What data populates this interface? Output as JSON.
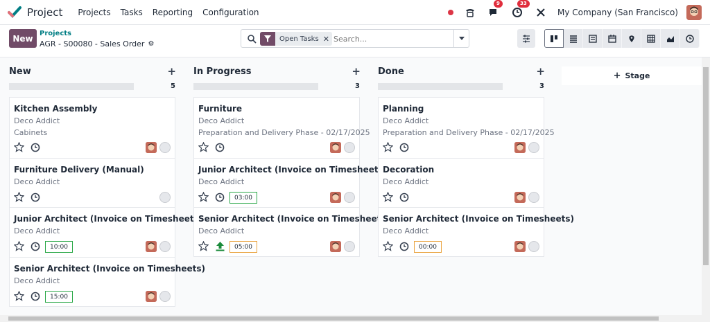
{
  "app": {
    "name": "Project",
    "logo_icon": "odoo-check-icon"
  },
  "nav": {
    "items": [
      "Projects",
      "Tasks",
      "Reporting",
      "Configuration"
    ]
  },
  "systray": {
    "phone_icon": "phone-icon",
    "chat_badge": "9",
    "activity_badge": "33",
    "company": "My Company (San Francisco)"
  },
  "control": {
    "new_label": "New",
    "breadcrumb_parent": "Projects",
    "breadcrumb_current": "AGR - S00080 - Sales Order",
    "search": {
      "facet": "Open Tasks",
      "placeholder": "Search..."
    }
  },
  "columns": [
    {
      "title": "New",
      "count": "5",
      "cards": [
        {
          "title": "Kitchen Assembly",
          "customer": "Deco Addict",
          "extra": "Cabinets",
          "hours": "",
          "avatar": true
        },
        {
          "title": "Furniture Delivery (Manual)",
          "customer": "Deco Addict",
          "extra": "",
          "hours": "",
          "avatar": false
        },
        {
          "title": "Junior Architect (Invoice on Timesheets)",
          "customer": "Deco Addict",
          "extra": "",
          "hours": "10:00",
          "avatar": true
        },
        {
          "title": "Senior Architect (Invoice on Timesheets)",
          "customer": "Deco Addict",
          "extra": "",
          "hours": "15:00",
          "avatar": true
        }
      ]
    },
    {
      "title": "In Progress",
      "count": "3",
      "cards": [
        {
          "title": "Furniture",
          "customer": "Deco Addict",
          "extra": "Preparation and Delivery Phase - 02/17/2025",
          "hours": "",
          "avatar": true
        },
        {
          "title": "Junior Architect (Invoice on Timesheets)",
          "customer": "Deco Addict",
          "extra": "",
          "hours": "03:00",
          "avatar": true
        },
        {
          "title": "Senior Architect (Invoice on Timesheets)",
          "customer": "Deco Addict",
          "extra": "",
          "hours": "05:00",
          "avatar": true
        }
      ]
    },
    {
      "title": "Done",
      "count": "3",
      "cards": [
        {
          "title": "Planning",
          "customer": "Deco Addict",
          "extra": "Preparation and Delivery Phase - 02/17/2025",
          "hours": "",
          "avatar": true
        },
        {
          "title": "Decoration",
          "customer": "Deco Addict",
          "extra": "",
          "hours": "",
          "avatar": true
        },
        {
          "title": "Senior Architect (Invoice on Timesheets)",
          "customer": "Deco Addict",
          "extra": "",
          "hours": "00:00",
          "avatar": true
        }
      ]
    }
  ],
  "stage_add_label": "Stage",
  "colors": {
    "brand": "#714b67",
    "link": "#017e84",
    "hours_ok": "#28a745",
    "hours_warn": "#e9a13b",
    "badge": "#e02d3c"
  }
}
